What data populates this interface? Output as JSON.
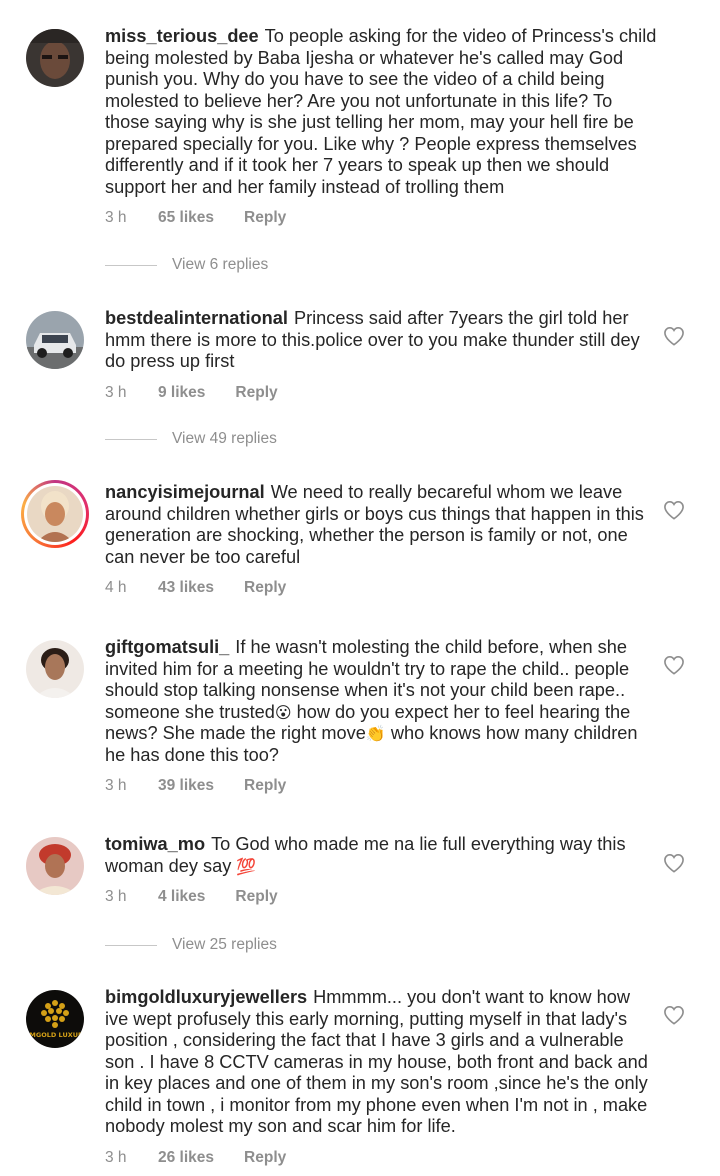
{
  "comments": [
    {
      "username": "miss_terious_dee",
      "text": "To people asking for the video of Princess's child being molested by Baba Ijesha or whatever he's called may God punish you. Why do you have to see the video of a child being molested to believe her? Are you not unfortunate in this life? To those saying why is she just telling her mom, may your hell fire be prepared specially for you. Like why ? People express themselves differently and if it took her 7 years to speak up then we should support her and her family instead of trolling them",
      "time": "3 h",
      "likes": "65 likes",
      "reply": "Reply",
      "view_replies": "View 6 replies"
    },
    {
      "username": "bestdealinternational",
      "text": "Princess said after 7years the girl told her hmm there is more to this.police over to you make thunder still dey do press up first",
      "time": "3 h",
      "likes": "9 likes",
      "reply": "Reply",
      "view_replies": "View 49 replies"
    },
    {
      "username": "nancyisimejournal",
      "text": "We need to really becareful whom we leave around children whether girls or boys cus things that happen in this generation are shocking, whether the person is family or not, one can never be too careful",
      "time": "4 h",
      "likes": "43 likes",
      "reply": "Reply"
    },
    {
      "username": "giftgomatsuli_",
      "text_parts": [
        "If he wasn't molesting the child before, when she invited him for a meeting he wouldn't try to rape the child.. people should stop talking nonsense when it's not your child been rape.. someone she trusted",
        "😮",
        " how do you expect her to feel hearing the news? She made the right move",
        "👏",
        " who knows how many children he has done this too?"
      ],
      "time": "3 h",
      "likes": "39 likes",
      "reply": "Reply"
    },
    {
      "username": "tomiwa_mo",
      "text_parts": [
        "To God who made me na lie full everything way this woman dey say ",
        "💯"
      ],
      "time": "3 h",
      "likes": "4 likes",
      "reply": "Reply",
      "view_replies": "View 25 replies"
    },
    {
      "username": "bimgoldluxuryjewellers",
      "text": "Hmmmm... you don't want to know how ive wept profusely this early morning,  putting myself in that lady's position , considering the fact that I have 3 girls and a vulnerable son . I have 8 CCTV  cameras in my house, both front and back and in key places and  one of them in my son's room ,since he's the only child in town , i monitor from my phone even when I'm not in , make nobody molest my son and scar him for life.",
      "time": "3 h",
      "likes": "26 likes",
      "reply": "Reply",
      "avatar_text": "IMGOLD LUXUR"
    }
  ],
  "colors": {
    "text": "#262626",
    "meta": "#8e8e8e",
    "divider": "#c7c7c7",
    "ring": "#e1306c",
    "gold": "#d4a017"
  },
  "icons": {
    "like": "heart-outline-icon"
  }
}
